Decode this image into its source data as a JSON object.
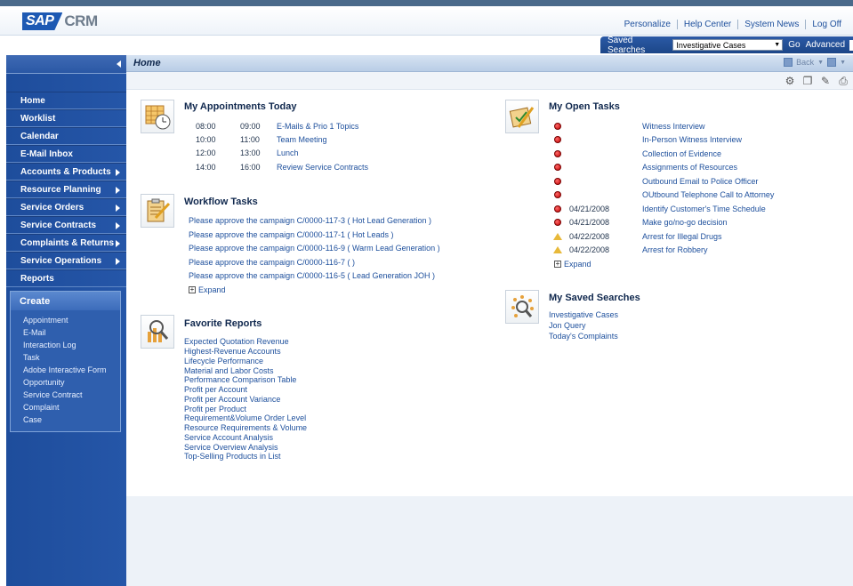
{
  "header": {
    "logo_sap": "SAP",
    "logo_crm": "CRM",
    "links": [
      "Personalize",
      "Help Center",
      "System News",
      "Log Off"
    ]
  },
  "search": {
    "label": "Saved Searches",
    "selected": "Investigative Cases",
    "go": "Go",
    "advanced": "Advanced"
  },
  "nav": {
    "items": [
      {
        "label": "Home",
        "arrow": false
      },
      {
        "label": "Worklist",
        "arrow": false
      },
      {
        "label": "Calendar",
        "arrow": false
      },
      {
        "label": "E-Mail Inbox",
        "arrow": false
      },
      {
        "label": "Accounts & Products",
        "arrow": true
      },
      {
        "label": "Resource Planning",
        "arrow": true
      },
      {
        "label": "Service Orders",
        "arrow": true
      },
      {
        "label": "Service Contracts",
        "arrow": true
      },
      {
        "label": "Complaints & Returns",
        "arrow": true
      },
      {
        "label": "Service Operations",
        "arrow": true
      },
      {
        "label": "Reports",
        "arrow": false
      }
    ],
    "create_title": "Create",
    "create_items": [
      "Appointment",
      "E-Mail",
      "Interaction Log",
      "Task",
      "Adobe Interactive Form",
      "Opportunity",
      "Service Contract",
      "Complaint",
      "Case"
    ]
  },
  "page": {
    "title": "Home",
    "back": "Back"
  },
  "appointments": {
    "title": "My Appointments Today",
    "rows": [
      {
        "start": "08:00",
        "end": "09:00",
        "desc": "E-Mails & Prio 1 Topics"
      },
      {
        "start": "10:00",
        "end": "11:00",
        "desc": "Team Meeting"
      },
      {
        "start": "12:00",
        "end": "13:00",
        "desc": "Lunch"
      },
      {
        "start": "14:00",
        "end": "16:00",
        "desc": "Review Service Contracts"
      }
    ]
  },
  "workflow": {
    "title": "Workflow Tasks",
    "items": [
      "Please approve the campaign C/0000-117-3 ( Hot Lead Generation )",
      "Please approve the campaign C/0000-117-1 ( Hot Leads )",
      "Please approve the campaign C/0000-116-9 ( Warm Lead Generation )",
      "Please approve the campaign C/0000-116-7 ( )",
      "Please approve the campaign C/0000-116-5 ( Lead Generation JOH )"
    ],
    "expand": "Expand"
  },
  "reports": {
    "title": "Favorite Reports",
    "items": [
      "Expected Quotation Revenue",
      "Highest-Revenue Accounts",
      "Lifecycle Performance",
      "Material and Labor Costs",
      "Performance Comparison Table",
      "Profit per Account",
      "Profit per Account Variance",
      "Profit per Product",
      "Requirement&Volume Order Level",
      "Resource Requirements & Volume",
      "Service Account Analysis",
      "Service Overview Analysis",
      "Top-Selling Products in List"
    ]
  },
  "tasks": {
    "title": "My Open Tasks",
    "rows": [
      {
        "status": "red",
        "date": "",
        "name": "Witness Interview"
      },
      {
        "status": "red",
        "date": "",
        "name": "In-Person Witness Interview"
      },
      {
        "status": "red",
        "date": "",
        "name": "Collection of Evidence"
      },
      {
        "status": "red",
        "date": "",
        "name": "Assignments of Resources"
      },
      {
        "status": "red",
        "date": "",
        "name": "Outbound Email to Police Officer"
      },
      {
        "status": "red",
        "date": "",
        "name": "OUtbound Telephone Call to Attorney"
      },
      {
        "status": "red",
        "date": "04/21/2008",
        "name": "Identify Customer's Time Schedule"
      },
      {
        "status": "red",
        "date": "04/21/2008",
        "name": "Make go/no-go decision"
      },
      {
        "status": "yellow",
        "date": "04/22/2008",
        "name": "Arrest for Illegal Drugs"
      },
      {
        "status": "yellow",
        "date": "04/22/2008",
        "name": "Arrest for Robbery"
      }
    ],
    "expand": "Expand"
  },
  "saved_searches": {
    "title": "My Saved Searches",
    "items": [
      "Investigative Cases",
      "Jon Query",
      "Today's Complaints"
    ]
  },
  "colors": {
    "nav_blue": "#2556a8",
    "link_blue": "#1d4f9c",
    "task_red": "#c10000",
    "task_yellow": "#e8b93a"
  }
}
